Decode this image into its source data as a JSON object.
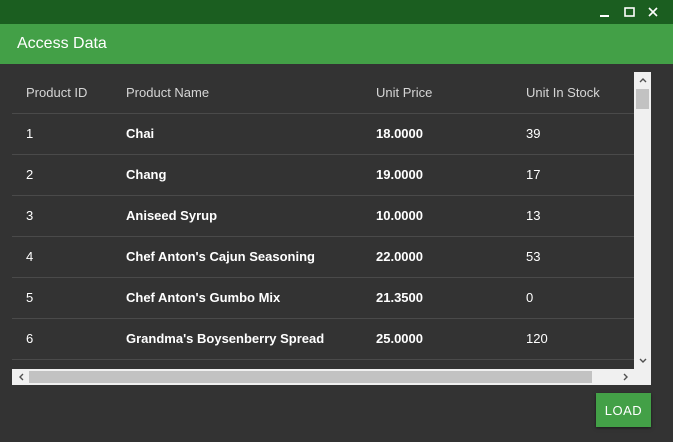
{
  "window": {
    "minimize_icon": "minimize-icon",
    "maximize_icon": "maximize-icon",
    "close_icon": "close-icon"
  },
  "appbar": {
    "title": "Access Data",
    "color": "#43a047",
    "titlebar_color": "#1b5e20"
  },
  "grid": {
    "columns": [
      "Product ID",
      "Product Name",
      "Unit Price",
      "Unit In Stock"
    ],
    "rows": [
      {
        "id": "1",
        "name": "Chai",
        "price": "18.0000",
        "stock": "39"
      },
      {
        "id": "2",
        "name": "Chang",
        "price": "19.0000",
        "stock": "17"
      },
      {
        "id": "3",
        "name": "Aniseed Syrup",
        "price": "10.0000",
        "stock": "13"
      },
      {
        "id": "4",
        "name": "Chef Anton's Cajun Seasoning",
        "price": "22.0000",
        "stock": "53"
      },
      {
        "id": "5",
        "name": "Chef Anton's Gumbo Mix",
        "price": "21.3500",
        "stock": "0"
      },
      {
        "id": "6",
        "name": "Grandma's Boysenberry Spread",
        "price": "25.0000",
        "stock": "120"
      }
    ]
  },
  "actions": {
    "load_label": "LOAD"
  }
}
